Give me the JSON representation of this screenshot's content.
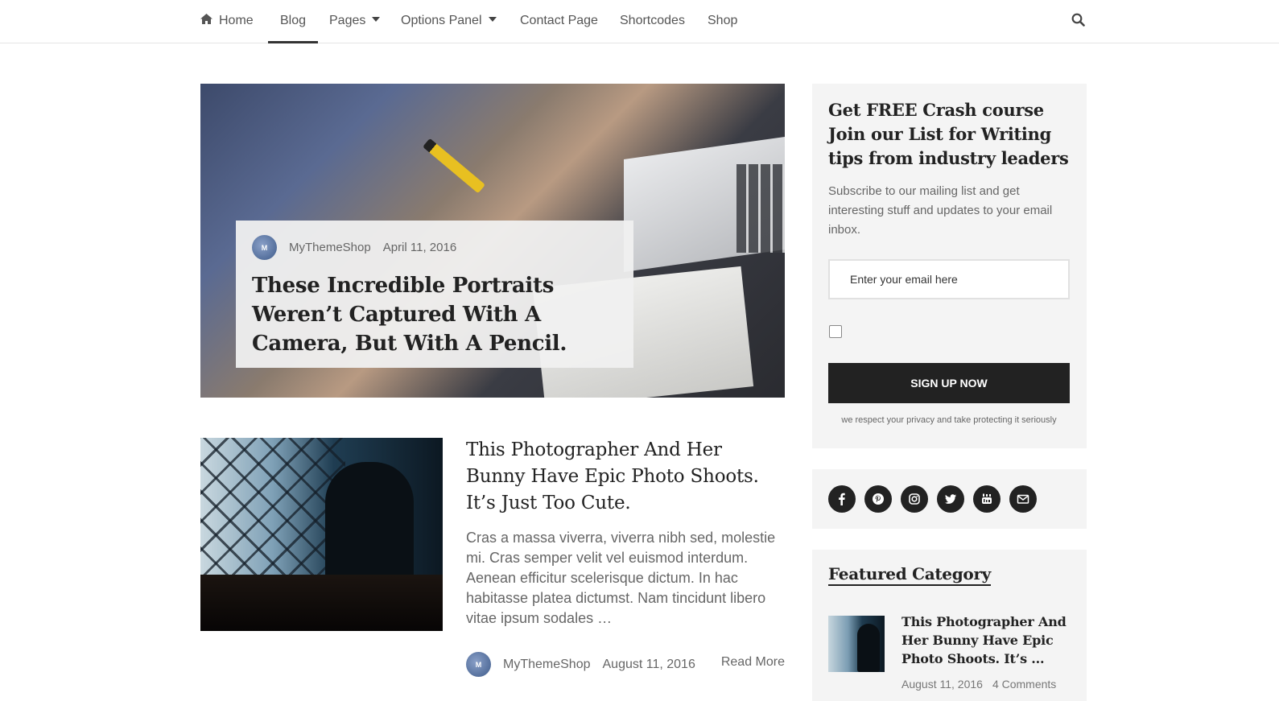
{
  "nav": {
    "items": [
      {
        "label": "Home",
        "icon": "home-icon"
      },
      {
        "label": "Blog",
        "active": true
      },
      {
        "label": "Pages",
        "dropdown": true
      },
      {
        "label": "Options Panel",
        "dropdown": true
      },
      {
        "label": "Contact Page"
      },
      {
        "label": "Shortcodes"
      },
      {
        "label": "Shop"
      }
    ],
    "search_icon": "search-icon"
  },
  "featured_post": {
    "author": "MyThemeShop",
    "date": "April 11, 2016",
    "title": "These Incredible Portraits Weren’t Captured With A Camera, But With A Pencil."
  },
  "post": {
    "title": "This Photographer And Her Bunny Have Epic Photo Shoots. It’s Just Too Cute.",
    "excerpt": "Cras a massa viverra, viverra nibh sed, molestie mi. Cras semper velit vel euismod interdum. Aenean efficitur scelerisque dictum. In hac habitasse platea dictumst. Nam tincidunt libero vitae ipsum sodales …",
    "author": "MyThemeShop",
    "date": "August 11, 2016",
    "read_more": "Read More"
  },
  "subscribe": {
    "heading": "Get FREE Crash course Join our List for Writing tips from industry leaders",
    "description": "Subscribe to our mailing list and get interesting stuff and updates to your email inbox.",
    "email_placeholder": "Enter your email here",
    "button_label": "SIGN UP NOW",
    "privacy_note": "we respect your privacy and take protecting it seriously"
  },
  "social": [
    "facebook-icon",
    "pinterest-icon",
    "instagram-icon",
    "twitter-icon",
    "youtube-icon",
    "email-icon"
  ],
  "featured_category": {
    "heading": "Featured Category",
    "post_title": "This Photographer And Her Bunny Have Epic Photo Shoots. It’s ...",
    "date": "August 11, 2016",
    "comments": "4 Comments"
  },
  "colors": {
    "text_dark": "#222222",
    "text_muted": "#666666",
    "widget_bg": "#f4f4f4",
    "button_bg": "#222222"
  }
}
